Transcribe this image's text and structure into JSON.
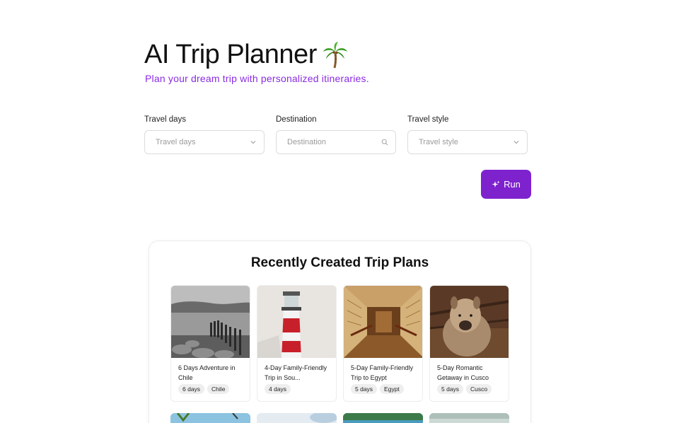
{
  "header": {
    "title": "AI Trip Planner",
    "title_icon": "palm-tree-icon",
    "subtitle": "Plan your dream trip with personalized itineraries."
  },
  "form": {
    "travel_days": {
      "label": "Travel days",
      "placeholder": "Travel days",
      "icon": "chevron-down-icon"
    },
    "destination": {
      "label": "Destination",
      "placeholder": "Destination",
      "icon": "search-icon"
    },
    "travel_style": {
      "label": "Travel style",
      "placeholder": "Travel style",
      "icon": "chevron-down-icon"
    },
    "run_label": "Run",
    "run_icon": "sparkle-icon"
  },
  "recent": {
    "title": "Recently Created Trip Plans",
    "cards": [
      {
        "title": "6 Days Adventure in Chile",
        "tags": [
          "6 days",
          "Chile"
        ],
        "image": "pier-landscape"
      },
      {
        "title": "4-Day Family-Friendly Trip in Sou...",
        "tags": [
          "4 days"
        ],
        "image": "lighthouse"
      },
      {
        "title": "5-Day Family-Friendly Trip to Egypt",
        "tags": [
          "5 days",
          "Egypt"
        ],
        "image": "egyptian-tomb"
      },
      {
        "title": "5-Day Romantic Getaway in Cusco",
        "tags": [
          "5 days",
          "Cusco"
        ],
        "image": "alpaca"
      }
    ]
  },
  "colors": {
    "accent": "#7e22ce",
    "subtitle": "#8a2be2"
  }
}
